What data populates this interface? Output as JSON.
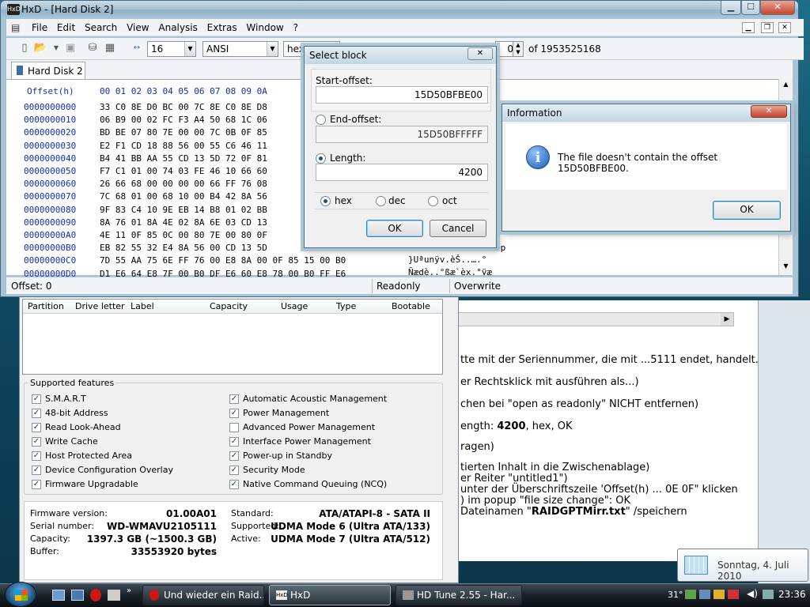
{
  "hxd": {
    "title": "HxD - [Hard Disk 2]",
    "menu": [
      "File",
      "Edit",
      "Search",
      "View",
      "Analysis",
      "Extras",
      "Window",
      "?"
    ],
    "bytes_per_row": "16",
    "charset": "ANSI",
    "numbase": "hex",
    "sector_value": "0",
    "sector_total": "of 1953525168",
    "tab": "Hard Disk 2",
    "offset_header": "Offset(h)",
    "column_header": "00 01 02 03 04 05 06 07 08 09 0A",
    "rows": [
      {
        "offset": "0000000000",
        "bytes": "33 C0 8E D0 BC 00 7C 8E C0 8E D8"
      },
      {
        "offset": "0000000010",
        "bytes": "06 B9 00 02 FC F3 A4 50 68 1C 06"
      },
      {
        "offset": "0000000020",
        "bytes": "BD BE 07 80 7E 00 00 7C 0B 0F 85"
      },
      {
        "offset": "0000000030",
        "bytes": "E2 F1 CD 18 88 56 00 55 C6 46 11"
      },
      {
        "offset": "0000000040",
        "bytes": "B4 41 BB AA 55 CD 13 5D 72 0F 81"
      },
      {
        "offset": "0000000050",
        "bytes": "F7 C1 01 00 74 03 FE 46 10 66 60"
      },
      {
        "offset": "0000000060",
        "bytes": "26 66 68 00 00 00 00 66 FF 76 08"
      },
      {
        "offset": "0000000070",
        "bytes": "7C 68 01 00 68 10 00 B4 42 8A 56"
      },
      {
        "offset": "0000000080",
        "bytes": "9F 83 C4 10 9E EB 14 B8 01 02 BB"
      },
      {
        "offset": "0000000090",
        "bytes": "8A 76 01 8A 4E 02 8A 6E 03 CD 13"
      },
      {
        "offset": "00000000A0",
        "bytes": "4E 11 0F 85 0C 00 80 7E 00 80 0F"
      },
      {
        "offset": "00000000B0",
        "bytes": "EB 82 55 32 E4 8A 56 00 CD 13 5D"
      },
      {
        "offset": "00000000C0",
        "bytes": "7D 55 AA 75 6E FF 76 00 E8 8A 00 0F 85 15 00 B0"
      },
      {
        "offset": "00000000D0",
        "bytes": "D1 E6 64 E8 7F 00 B0 DF E6 60 E8 78 00 B0 FF E6"
      }
    ],
    "ascii_c0": "}Uªunÿv.èŠ..….°",
    "ascii_d0": "Ñædè..°ßæ`èx.°ÿæ",
    "ascii_b0": ">p",
    "status": {
      "offset": "Offset: 0",
      "readonly": "Readonly",
      "overwrite": "Overwrite"
    }
  },
  "select_block": {
    "title": "Select block",
    "start_label": "Start-offset:",
    "start_value": "15D50BFBE00",
    "end_label": "End-offset:",
    "end_value": "15D50BFFFFF",
    "length_label": "Length:",
    "length_value": "4200",
    "bases": [
      "hex",
      "dec",
      "oct"
    ],
    "ok": "OK",
    "cancel": "Cancel"
  },
  "info": {
    "title": "Information",
    "message": "The file doesn't contain the offset 15D50BFBE00.",
    "ok": "OK"
  },
  "hdtune": {
    "columns": [
      "Partition",
      "Drive letter",
      "Label",
      "Capacity",
      "Usage",
      "Type",
      "Bootable"
    ],
    "features_title": "Supported features",
    "features_left": [
      {
        "label": "S.M.A.R.T",
        "checked": true
      },
      {
        "label": "48-bit Address",
        "checked": true
      },
      {
        "label": "Read Look-Ahead",
        "checked": true
      },
      {
        "label": "Write Cache",
        "checked": true
      },
      {
        "label": "Host Protected Area",
        "checked": true
      },
      {
        "label": "Device Configuration Overlay",
        "checked": true
      },
      {
        "label": "Firmware Upgradable",
        "checked": true
      }
    ],
    "features_right": [
      {
        "label": "Automatic Acoustic Management",
        "checked": true
      },
      {
        "label": "Power Management",
        "checked": true
      },
      {
        "label": "Advanced Power Management",
        "checked": false
      },
      {
        "label": "Interface Power Management",
        "checked": true
      },
      {
        "label": "Power-up in Standby",
        "checked": true
      },
      {
        "label": "Security Mode",
        "checked": true
      },
      {
        "label": "Native Command Queuing (NCQ)",
        "checked": true
      }
    ],
    "info_left": [
      {
        "k": "Firmware version:",
        "v": "01.00A01"
      },
      {
        "k": "Serial number:",
        "v": "WD-WMAVU2105111"
      },
      {
        "k": "Capacity:",
        "v": "1397.3 GB (~1500.3 GB)"
      },
      {
        "k": "Buffer:",
        "v": "33553920 bytes"
      }
    ],
    "info_right": [
      {
        "k": "Standard:",
        "v": "ATA/ATAPI-8 - SATA II"
      },
      {
        "k": "Supported:",
        "v": "UDMA Mode 6 (Ultra ATA/133)"
      },
      {
        "k": "Active:",
        "v": "UDMA Mode 7 (Ultra ATA/512)"
      }
    ]
  },
  "notes": {
    "lines": [
      {
        "text": "tte mit der Seriennummer, die mit ...5111 endet, handelt.",
        "bold": ""
      },
      {
        "text": "er Rechtsklick mit ausführen als...)",
        "bold": ""
      },
      {
        "text": "chen bei \"open as readonly\" NICHT entfernen)",
        "bold": ""
      },
      {
        "text": "ength: ",
        "bold": "4200",
        "after": ", hex, OK"
      },
      {
        "text": "ragen)",
        "bold": ""
      },
      {
        "text": "tierten Inhalt in die Zwischenablage)",
        "bold": ""
      },
      {
        "text": "er Reiter \"untitled1\")",
        "bold": ""
      },
      {
        "text": "unter der Überschriftszeile 'Offset(h) ... 0E 0F\" klicken",
        "bold": ""
      },
      {
        "text": ") im popup \"file size change\": OK",
        "bold": ""
      },
      {
        "text": "Dateinamen \"",
        "bold": "RAIDGPTMirr.txt",
        "after": "\" /speichern"
      }
    ]
  },
  "taskbar": {
    "tasks": [
      "Und wieder ein Raid...",
      "HxD",
      "HD Tune 2.55 - Har..."
    ],
    "temp": "31°",
    "time": "23:36",
    "date_tooltip": "Sonntag, 4. Juli 2010"
  }
}
